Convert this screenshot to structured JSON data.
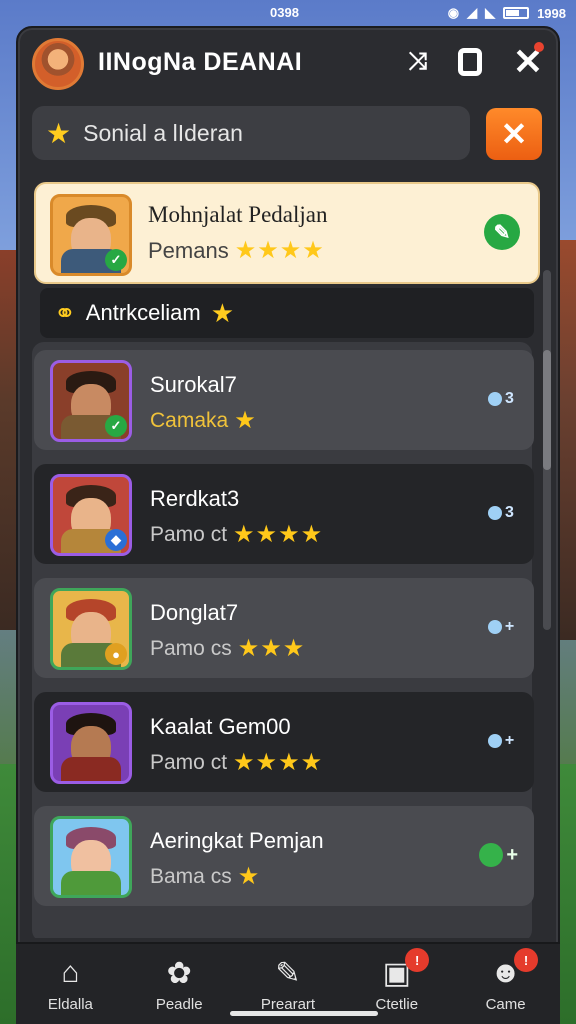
{
  "status_bar": {
    "time": "0398",
    "right_text": "1998"
  },
  "header": {
    "title": "IINogNa DEANAI"
  },
  "search": {
    "value": "Sonial a lIderan"
  },
  "featured": {
    "title": "Mohnjalat Pedaljan",
    "subtitle": "Pemans",
    "stars": "★★★★"
  },
  "section": {
    "label": "Antrkceliam",
    "star": "★"
  },
  "items": [
    {
      "title": "Surokal7",
      "subtitle": "Camaka",
      "stars": "★",
      "action": "3",
      "theme": "dark-face"
    },
    {
      "title": "Rerdkat3",
      "subtitle": "Pamo ct",
      "stars": "★★★★",
      "action": "3",
      "theme": "hero"
    },
    {
      "title": "Donglat7",
      "subtitle": "Pamo cs",
      "stars": "★★★",
      "action": "+",
      "theme": "warrior"
    },
    {
      "title": "Kaalat Gem00",
      "subtitle": "Pamo ct",
      "stars": "★★★★",
      "action": "+",
      "theme": "bearded"
    },
    {
      "title": "Aeringkat Pemjan",
      "subtitle": "Bama cs",
      "stars": "★",
      "action": "+",
      "theme": "farmer"
    }
  ],
  "nav": [
    {
      "label": "Eldalla",
      "icon": "home-icon",
      "badge": ""
    },
    {
      "label": "Peadle",
      "icon": "puzzle-icon",
      "badge": ""
    },
    {
      "label": "Prearart",
      "icon": "edit-icon",
      "badge": ""
    },
    {
      "label": "Ctetlie",
      "icon": "gamepad-icon",
      "badge": "!"
    },
    {
      "label": "Came",
      "icon": "user-icon",
      "badge": "!"
    }
  ],
  "colors": {
    "accent": "#ec5f12",
    "star": "#ffc81a",
    "panel": "#2b2c30",
    "featured_bg": "#fdf0d4"
  }
}
